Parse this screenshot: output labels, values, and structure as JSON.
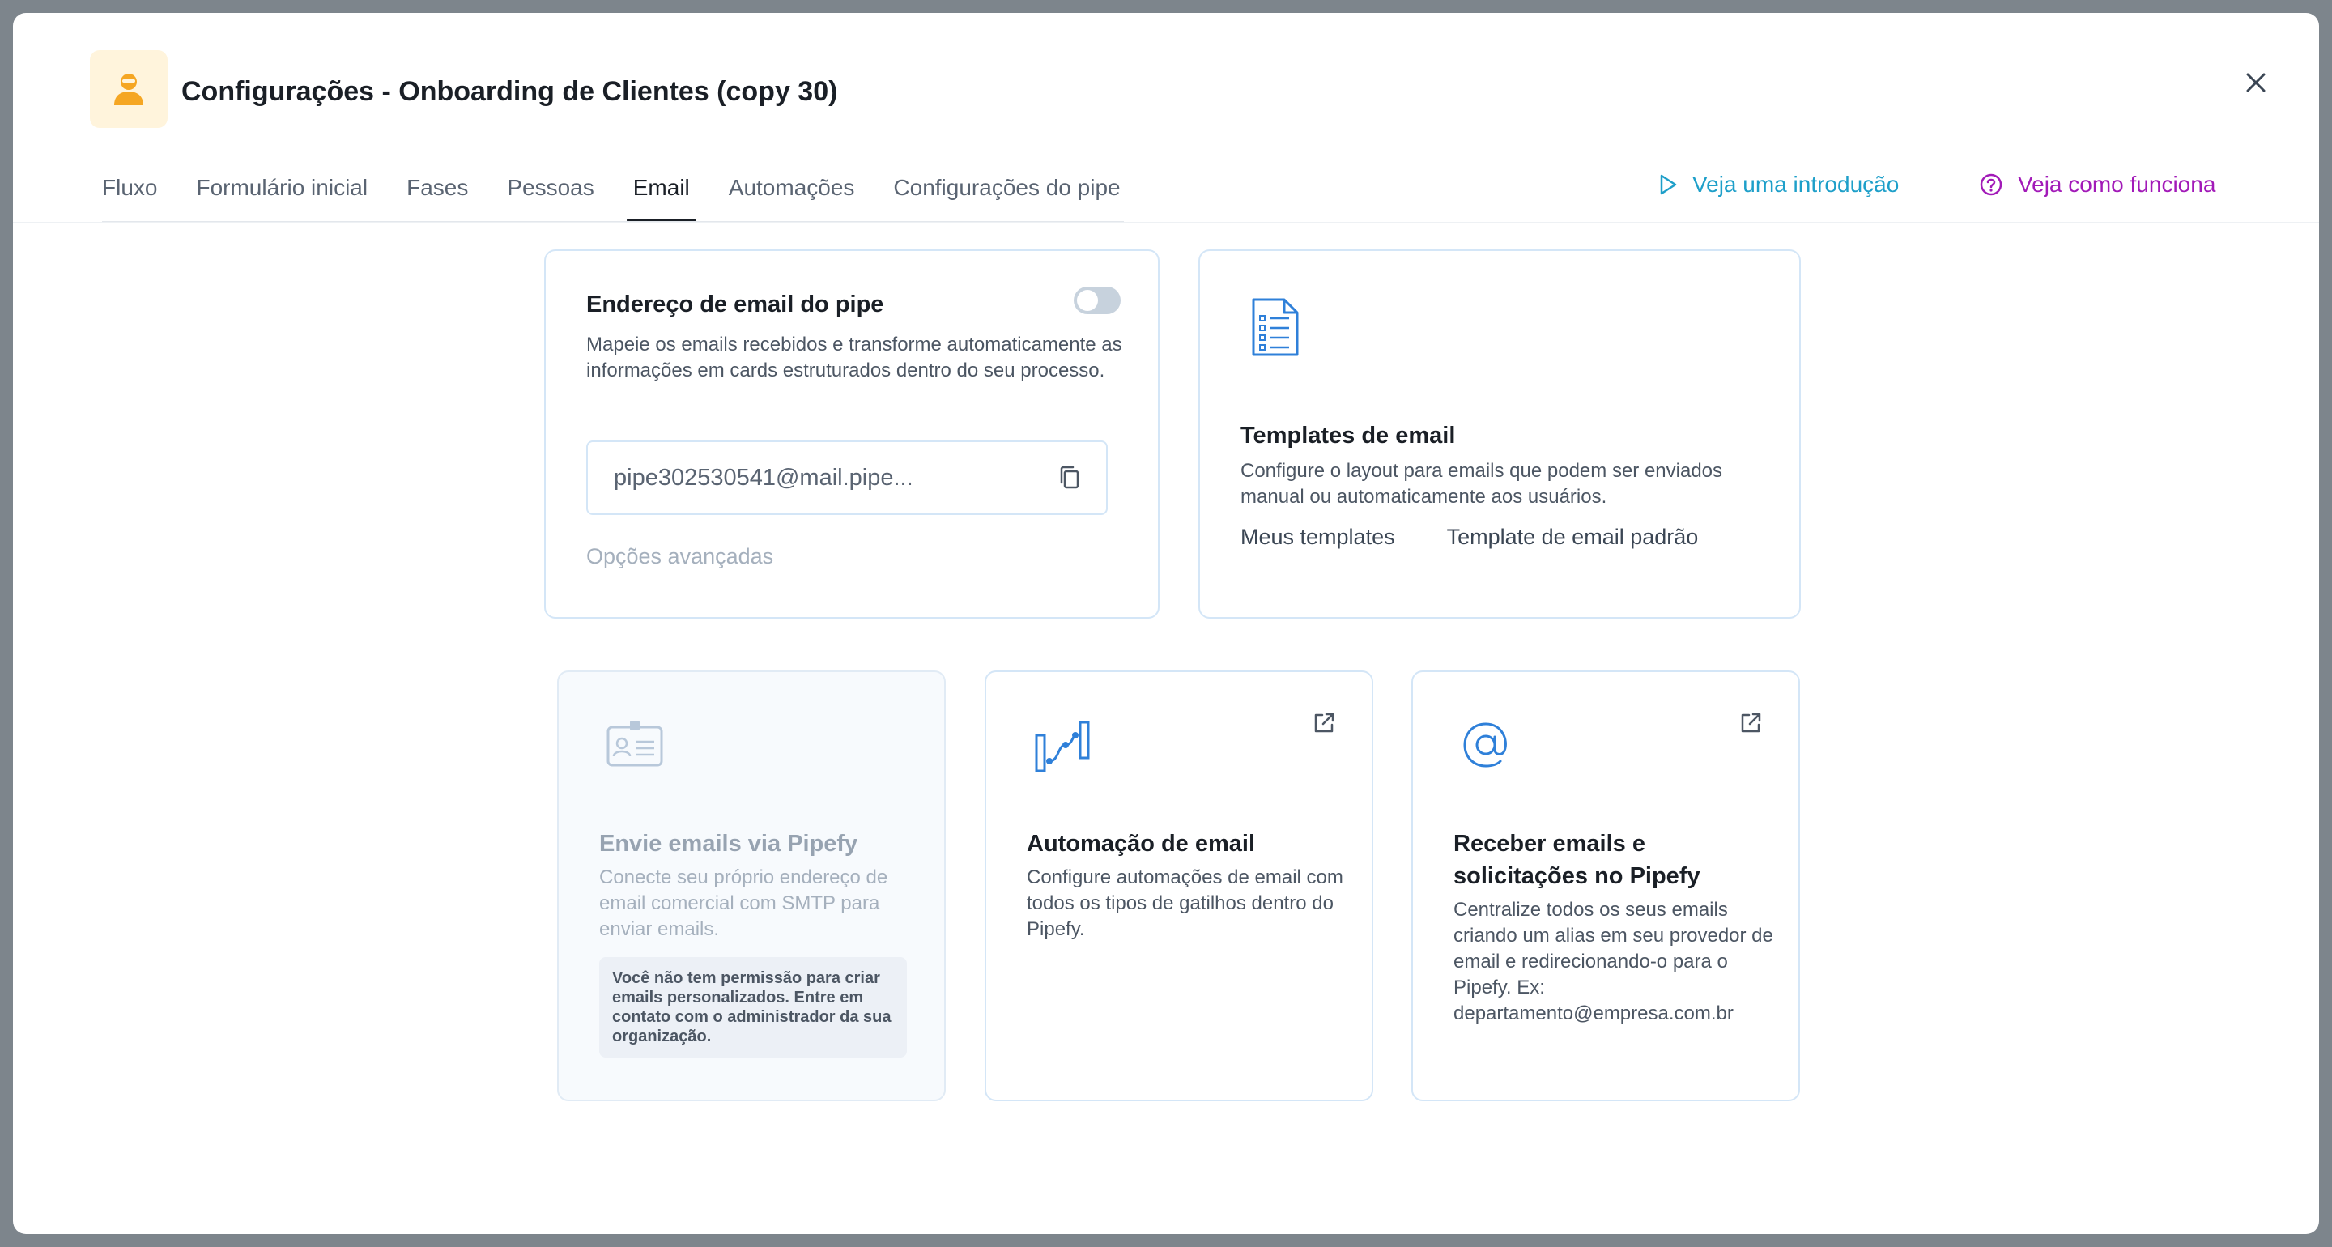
{
  "header": {
    "title": "Configurações - Onboarding de Clientes (copy 30)",
    "icon": "person-icon",
    "accent": "#f5a623"
  },
  "tabs": [
    {
      "label": "Fluxo",
      "active": false
    },
    {
      "label": "Formulário inicial",
      "active": false
    },
    {
      "label": "Fases",
      "active": false
    },
    {
      "label": "Pessoas",
      "active": false
    },
    {
      "label": "Email",
      "active": true
    },
    {
      "label": "Automações",
      "active": false
    },
    {
      "label": "Configurações do pipe",
      "active": false
    }
  ],
  "links": {
    "intro": "Veja uma introdução",
    "how": "Veja como funciona",
    "intro_color": "#1e9fc9",
    "how_color": "#a21ab8"
  },
  "pipe_email_card": {
    "title": "Endereço de email do pipe",
    "description": "Mapeie os emails recebidos e transforme automaticamente as informações em cards estruturados dentro do seu processo.",
    "email": "pipe302530541@mail.pipe...",
    "advanced": "Opções avançadas",
    "toggle_on": false
  },
  "templates_card": {
    "title": "Templates de email",
    "description": "Configure o layout para emails que podem ser enviados manual ou automaticamente aos usuários.",
    "link_my": "Meus templates",
    "link_default": "Template de email padrão"
  },
  "smtp_card": {
    "title": "Envie emails via Pipefy",
    "description": "Conecte seu próprio endereço de email comercial com SMTP para enviar emails.",
    "permission_note": "Você não tem permissão para criar emails personalizados. Entre em contato com o administrador da sua organização."
  },
  "automation_card": {
    "title": "Automação de email",
    "description": "Configure automações de email com todos os tipos de gatilhos dentro do Pipefy."
  },
  "receive_card": {
    "title": "Receber emails e solicitações no Pipefy",
    "description": "Centralize todos os seus emails criando um alias em seu provedor de email e redirecionando-o para o Pipefy. Ex: departamento@empresa.com.br"
  }
}
